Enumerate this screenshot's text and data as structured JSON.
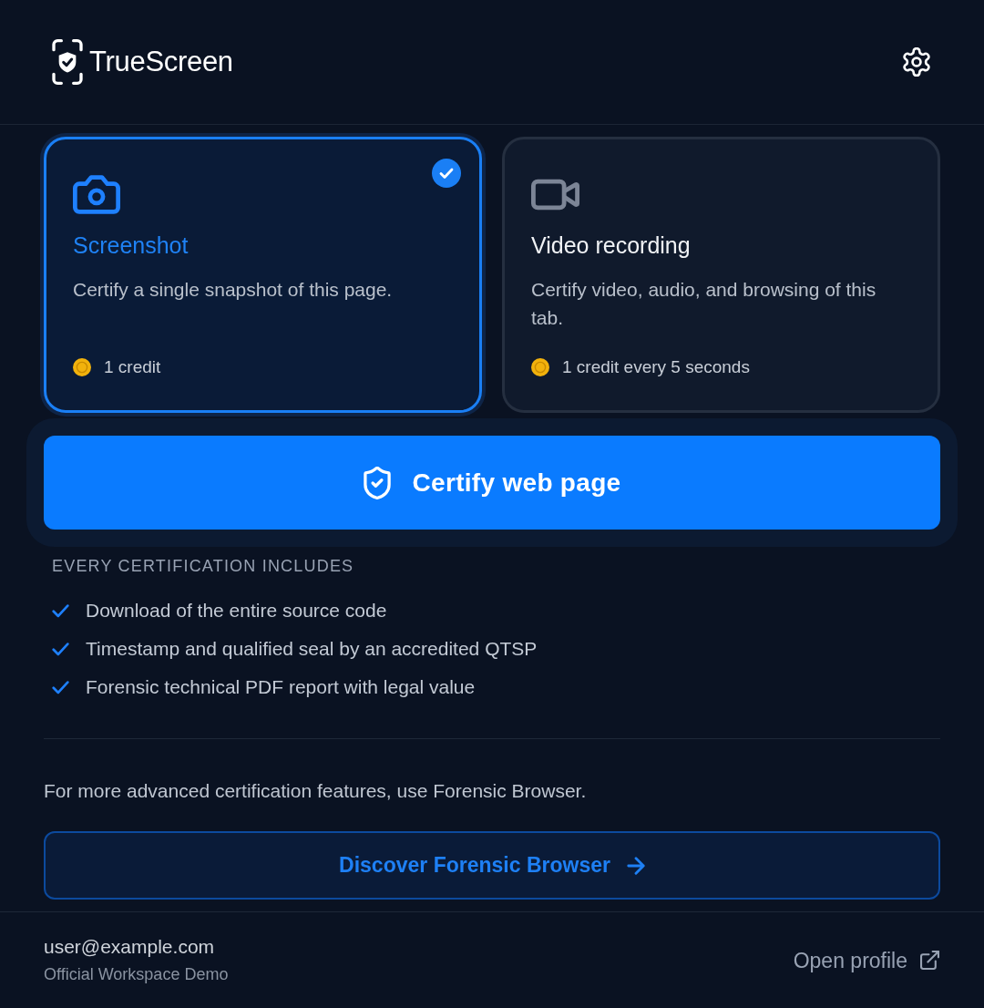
{
  "header": {
    "logo_text": "TrueScreen"
  },
  "modes": [
    {
      "kind": "screenshot",
      "title": "Screenshot",
      "description": "Certify a single snapshot of this page.",
      "cost": "1 credit",
      "selected": true
    },
    {
      "kind": "video",
      "title": "Video recording",
      "description": "Certify video, audio, and browsing of this tab.",
      "cost": "1 credit every 5 seconds",
      "selected": false
    }
  ],
  "certify_button": {
    "label": "Certify web page"
  },
  "includes": {
    "heading": "EVERY CERTIFICATION INCLUDES",
    "items": [
      "Download of the entire source code",
      "Timestamp and qualified seal by an accredited QTSP",
      "Forensic technical PDF report with legal value"
    ]
  },
  "promo": {
    "text": "For more advanced certification features, use Forensic Browser.",
    "button": "Discover Forensic Browser"
  },
  "footer": {
    "email": "user@example.com",
    "workspace": "Official Workspace Demo",
    "profile_link": "Open profile"
  }
}
